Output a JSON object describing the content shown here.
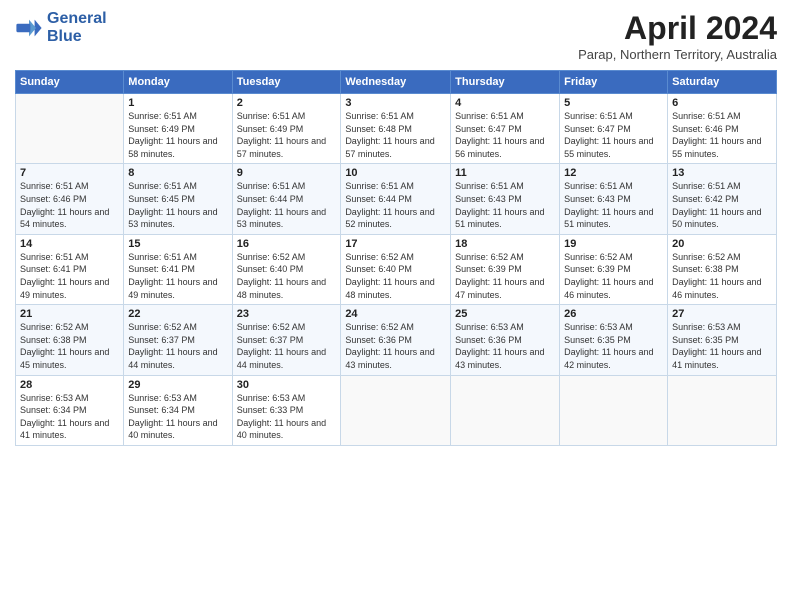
{
  "logo": {
    "line1": "General",
    "line2": "Blue"
  },
  "title": "April 2024",
  "subtitle": "Parap, Northern Territory, Australia",
  "days_header": [
    "Sunday",
    "Monday",
    "Tuesday",
    "Wednesday",
    "Thursday",
    "Friday",
    "Saturday"
  ],
  "weeks": [
    [
      {
        "day": "",
        "sunrise": "",
        "sunset": "",
        "daylight": ""
      },
      {
        "day": "1",
        "sunrise": "Sunrise: 6:51 AM",
        "sunset": "Sunset: 6:49 PM",
        "daylight": "Daylight: 11 hours and 58 minutes."
      },
      {
        "day": "2",
        "sunrise": "Sunrise: 6:51 AM",
        "sunset": "Sunset: 6:49 PM",
        "daylight": "Daylight: 11 hours and 57 minutes."
      },
      {
        "day": "3",
        "sunrise": "Sunrise: 6:51 AM",
        "sunset": "Sunset: 6:48 PM",
        "daylight": "Daylight: 11 hours and 57 minutes."
      },
      {
        "day": "4",
        "sunrise": "Sunrise: 6:51 AM",
        "sunset": "Sunset: 6:47 PM",
        "daylight": "Daylight: 11 hours and 56 minutes."
      },
      {
        "day": "5",
        "sunrise": "Sunrise: 6:51 AM",
        "sunset": "Sunset: 6:47 PM",
        "daylight": "Daylight: 11 hours and 55 minutes."
      },
      {
        "day": "6",
        "sunrise": "Sunrise: 6:51 AM",
        "sunset": "Sunset: 6:46 PM",
        "daylight": "Daylight: 11 hours and 55 minutes."
      }
    ],
    [
      {
        "day": "7",
        "sunrise": "Sunrise: 6:51 AM",
        "sunset": "Sunset: 6:46 PM",
        "daylight": "Daylight: 11 hours and 54 minutes."
      },
      {
        "day": "8",
        "sunrise": "Sunrise: 6:51 AM",
        "sunset": "Sunset: 6:45 PM",
        "daylight": "Daylight: 11 hours and 53 minutes."
      },
      {
        "day": "9",
        "sunrise": "Sunrise: 6:51 AM",
        "sunset": "Sunset: 6:44 PM",
        "daylight": "Daylight: 11 hours and 53 minutes."
      },
      {
        "day": "10",
        "sunrise": "Sunrise: 6:51 AM",
        "sunset": "Sunset: 6:44 PM",
        "daylight": "Daylight: 11 hours and 52 minutes."
      },
      {
        "day": "11",
        "sunrise": "Sunrise: 6:51 AM",
        "sunset": "Sunset: 6:43 PM",
        "daylight": "Daylight: 11 hours and 51 minutes."
      },
      {
        "day": "12",
        "sunrise": "Sunrise: 6:51 AM",
        "sunset": "Sunset: 6:43 PM",
        "daylight": "Daylight: 11 hours and 51 minutes."
      },
      {
        "day": "13",
        "sunrise": "Sunrise: 6:51 AM",
        "sunset": "Sunset: 6:42 PM",
        "daylight": "Daylight: 11 hours and 50 minutes."
      }
    ],
    [
      {
        "day": "14",
        "sunrise": "Sunrise: 6:51 AM",
        "sunset": "Sunset: 6:41 PM",
        "daylight": "Daylight: 11 hours and 49 minutes."
      },
      {
        "day": "15",
        "sunrise": "Sunrise: 6:51 AM",
        "sunset": "Sunset: 6:41 PM",
        "daylight": "Daylight: 11 hours and 49 minutes."
      },
      {
        "day": "16",
        "sunrise": "Sunrise: 6:52 AM",
        "sunset": "Sunset: 6:40 PM",
        "daylight": "Daylight: 11 hours and 48 minutes."
      },
      {
        "day": "17",
        "sunrise": "Sunrise: 6:52 AM",
        "sunset": "Sunset: 6:40 PM",
        "daylight": "Daylight: 11 hours and 48 minutes."
      },
      {
        "day": "18",
        "sunrise": "Sunrise: 6:52 AM",
        "sunset": "Sunset: 6:39 PM",
        "daylight": "Daylight: 11 hours and 47 minutes."
      },
      {
        "day": "19",
        "sunrise": "Sunrise: 6:52 AM",
        "sunset": "Sunset: 6:39 PM",
        "daylight": "Daylight: 11 hours and 46 minutes."
      },
      {
        "day": "20",
        "sunrise": "Sunrise: 6:52 AM",
        "sunset": "Sunset: 6:38 PM",
        "daylight": "Daylight: 11 hours and 46 minutes."
      }
    ],
    [
      {
        "day": "21",
        "sunrise": "Sunrise: 6:52 AM",
        "sunset": "Sunset: 6:38 PM",
        "daylight": "Daylight: 11 hours and 45 minutes."
      },
      {
        "day": "22",
        "sunrise": "Sunrise: 6:52 AM",
        "sunset": "Sunset: 6:37 PM",
        "daylight": "Daylight: 11 hours and 44 minutes."
      },
      {
        "day": "23",
        "sunrise": "Sunrise: 6:52 AM",
        "sunset": "Sunset: 6:37 PM",
        "daylight": "Daylight: 11 hours and 44 minutes."
      },
      {
        "day": "24",
        "sunrise": "Sunrise: 6:52 AM",
        "sunset": "Sunset: 6:36 PM",
        "daylight": "Daylight: 11 hours and 43 minutes."
      },
      {
        "day": "25",
        "sunrise": "Sunrise: 6:53 AM",
        "sunset": "Sunset: 6:36 PM",
        "daylight": "Daylight: 11 hours and 43 minutes."
      },
      {
        "day": "26",
        "sunrise": "Sunrise: 6:53 AM",
        "sunset": "Sunset: 6:35 PM",
        "daylight": "Daylight: 11 hours and 42 minutes."
      },
      {
        "day": "27",
        "sunrise": "Sunrise: 6:53 AM",
        "sunset": "Sunset: 6:35 PM",
        "daylight": "Daylight: 11 hours and 41 minutes."
      }
    ],
    [
      {
        "day": "28",
        "sunrise": "Sunrise: 6:53 AM",
        "sunset": "Sunset: 6:34 PM",
        "daylight": "Daylight: 11 hours and 41 minutes."
      },
      {
        "day": "29",
        "sunrise": "Sunrise: 6:53 AM",
        "sunset": "Sunset: 6:34 PM",
        "daylight": "Daylight: 11 hours and 40 minutes."
      },
      {
        "day": "30",
        "sunrise": "Sunrise: 6:53 AM",
        "sunset": "Sunset: 6:33 PM",
        "daylight": "Daylight: 11 hours and 40 minutes."
      },
      {
        "day": "",
        "sunrise": "",
        "sunset": "",
        "daylight": ""
      },
      {
        "day": "",
        "sunrise": "",
        "sunset": "",
        "daylight": ""
      },
      {
        "day": "",
        "sunrise": "",
        "sunset": "",
        "daylight": ""
      },
      {
        "day": "",
        "sunrise": "",
        "sunset": "",
        "daylight": ""
      }
    ]
  ]
}
